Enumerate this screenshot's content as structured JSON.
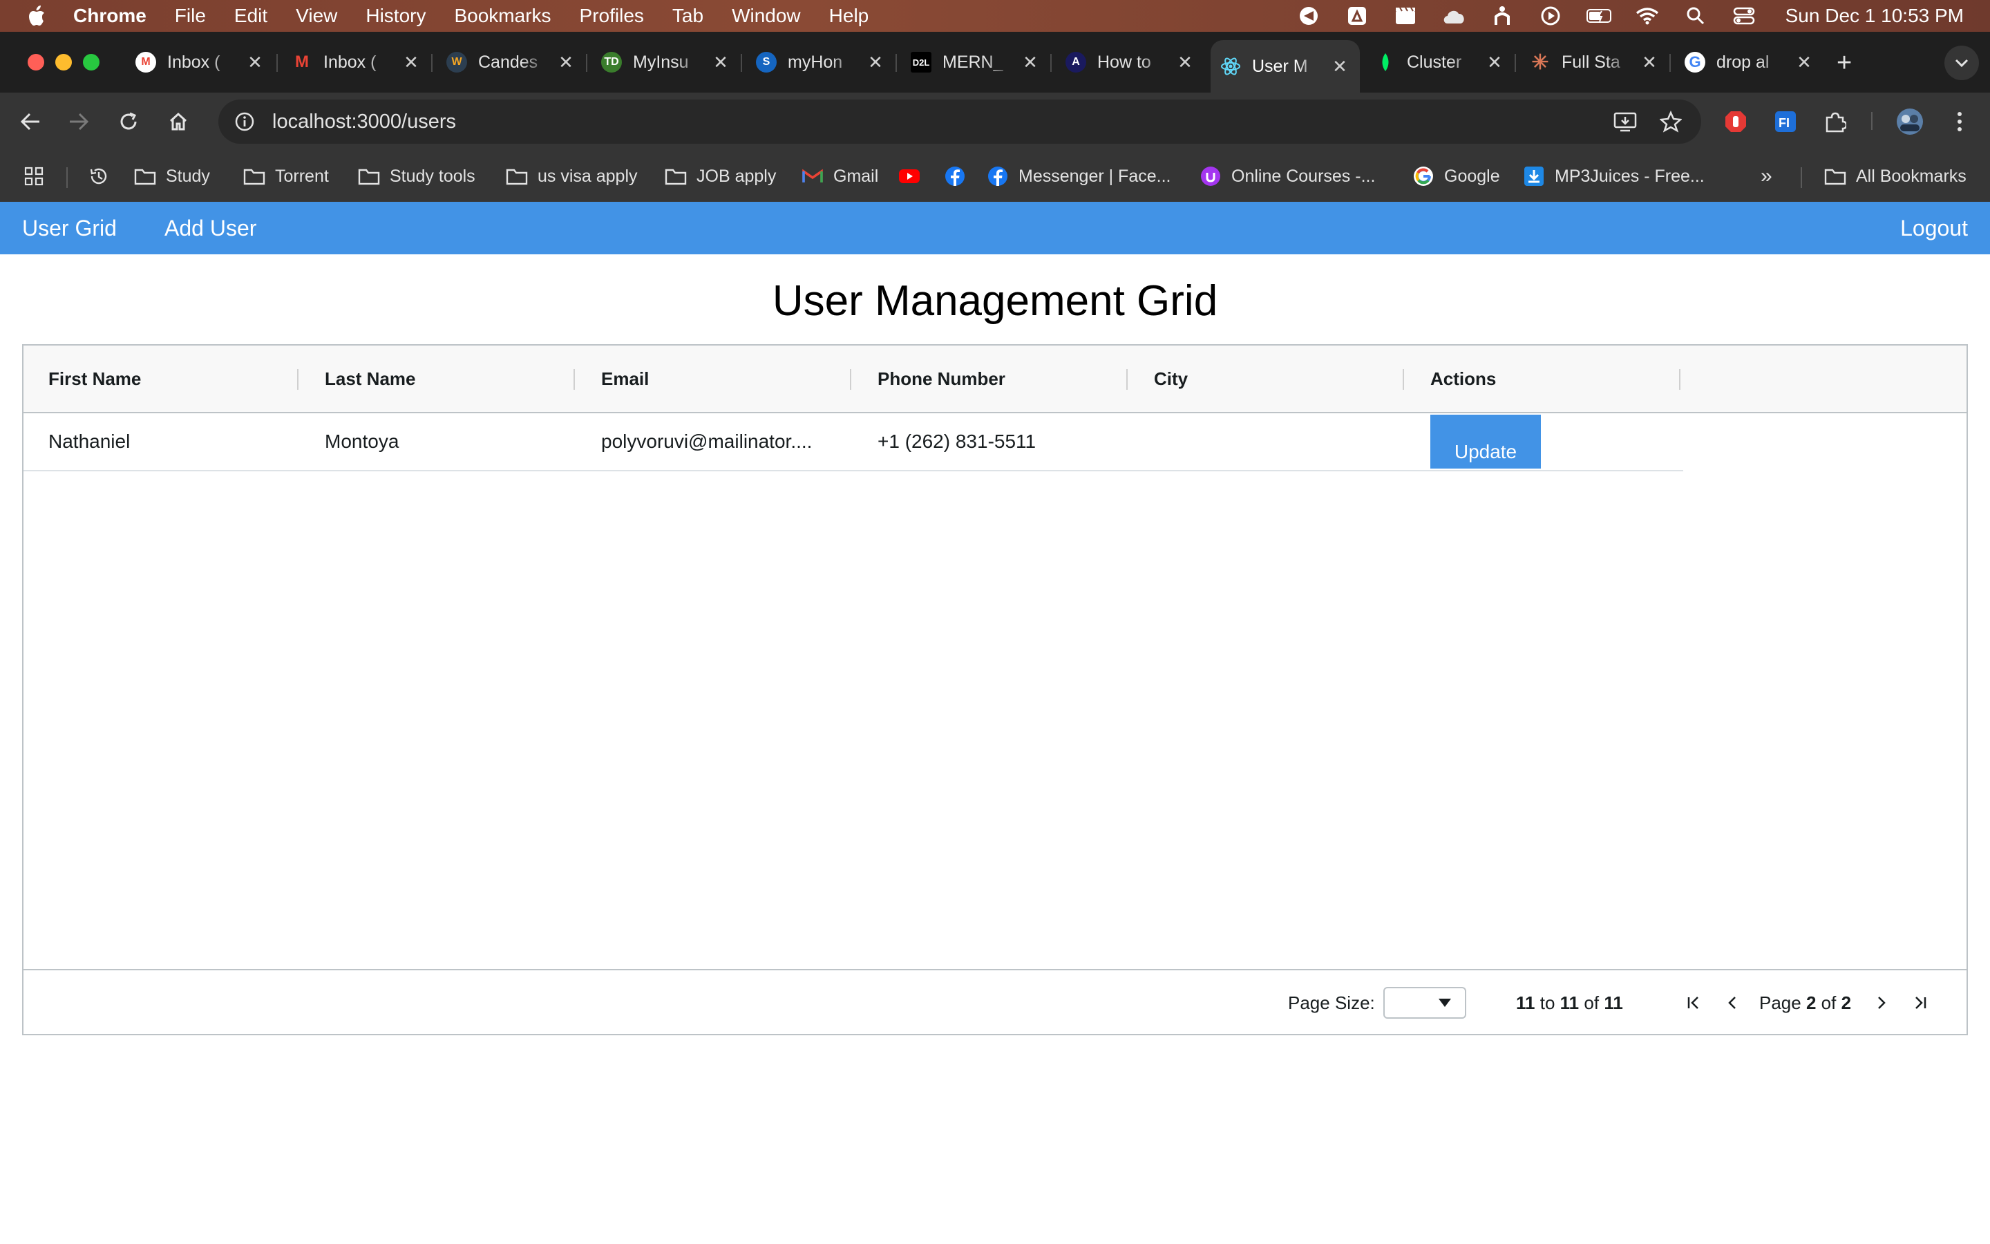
{
  "menubar": {
    "app_name": "Chrome",
    "items": [
      "File",
      "Edit",
      "View",
      "History",
      "Bookmarks",
      "Profiles",
      "Tab",
      "Window",
      "Help"
    ],
    "clock": "Sun Dec 1  10:53 PM"
  },
  "tabs": [
    {
      "label": "Inbox (",
      "icon": "gmail-icon",
      "color": "#ea4335"
    },
    {
      "label": "Inbox (",
      "icon": "gmail-icon",
      "color": "#ea4335"
    },
    {
      "label": "Candes",
      "icon": "candescent-icon",
      "color": "#4a90d9"
    },
    {
      "label": "MyInsu",
      "icon": "td-icon",
      "color": "#2e7d32"
    },
    {
      "label": "myHon",
      "icon": "myhome-icon",
      "color": "#1565c0"
    },
    {
      "label": "MERN_",
      "icon": "d2l-icon",
      "color": "#000000"
    },
    {
      "label": "How to",
      "icon": "angular-icon",
      "color": "#1a1a5e"
    },
    {
      "label": "User M",
      "icon": "react-icon",
      "color": "#61dafb",
      "active": true
    },
    {
      "label": "Cluster",
      "icon": "mongodb-icon",
      "color": "#00ed64"
    },
    {
      "label": "Full Sta",
      "icon": "claude-icon",
      "color": "#d97757"
    },
    {
      "label": "drop al",
      "icon": "google-icon",
      "color": "#4285f4"
    }
  ],
  "address_bar": {
    "url": "localhost:3000/users"
  },
  "bookmarks": {
    "items": [
      "Study",
      "Torrent",
      "Study tools",
      "us visa apply",
      "JOB apply",
      "Gmail",
      "Messenger | Face...",
      "Online Courses -...",
      "Google",
      "MP3Juices - Free..."
    ],
    "all_bookmarks": "All Bookmarks",
    "overflow": "»"
  },
  "app": {
    "nav": {
      "user_grid": "User Grid",
      "add_user": "Add User",
      "logout": "Logout"
    },
    "title": "User Management Grid",
    "columns": [
      "First Name",
      "Last Name",
      "Email",
      "Phone Number",
      "City",
      "Actions"
    ],
    "rows": [
      {
        "first_name": "Nathaniel",
        "last_name": "Montoya",
        "email": "polyvoruvi@mailinator....",
        "phone": "+1 (262) 831-5511",
        "city": "",
        "action_label": "Update"
      }
    ],
    "pagination": {
      "page_size_label": "Page Size:",
      "page_size_value": "",
      "range_from": "11",
      "range_to_word": "to",
      "range_to": "11",
      "range_of_word": "of",
      "total": "11",
      "page_word": "Page",
      "current_page": "2",
      "of_word": "of",
      "total_pages": "2"
    }
  },
  "colors": {
    "app_nav_bg": "#4293e6",
    "update_button_bg": "#4293e6",
    "chrome_toolbar_bg": "#353535",
    "tabstrip_bg": "#1f1f1f"
  }
}
